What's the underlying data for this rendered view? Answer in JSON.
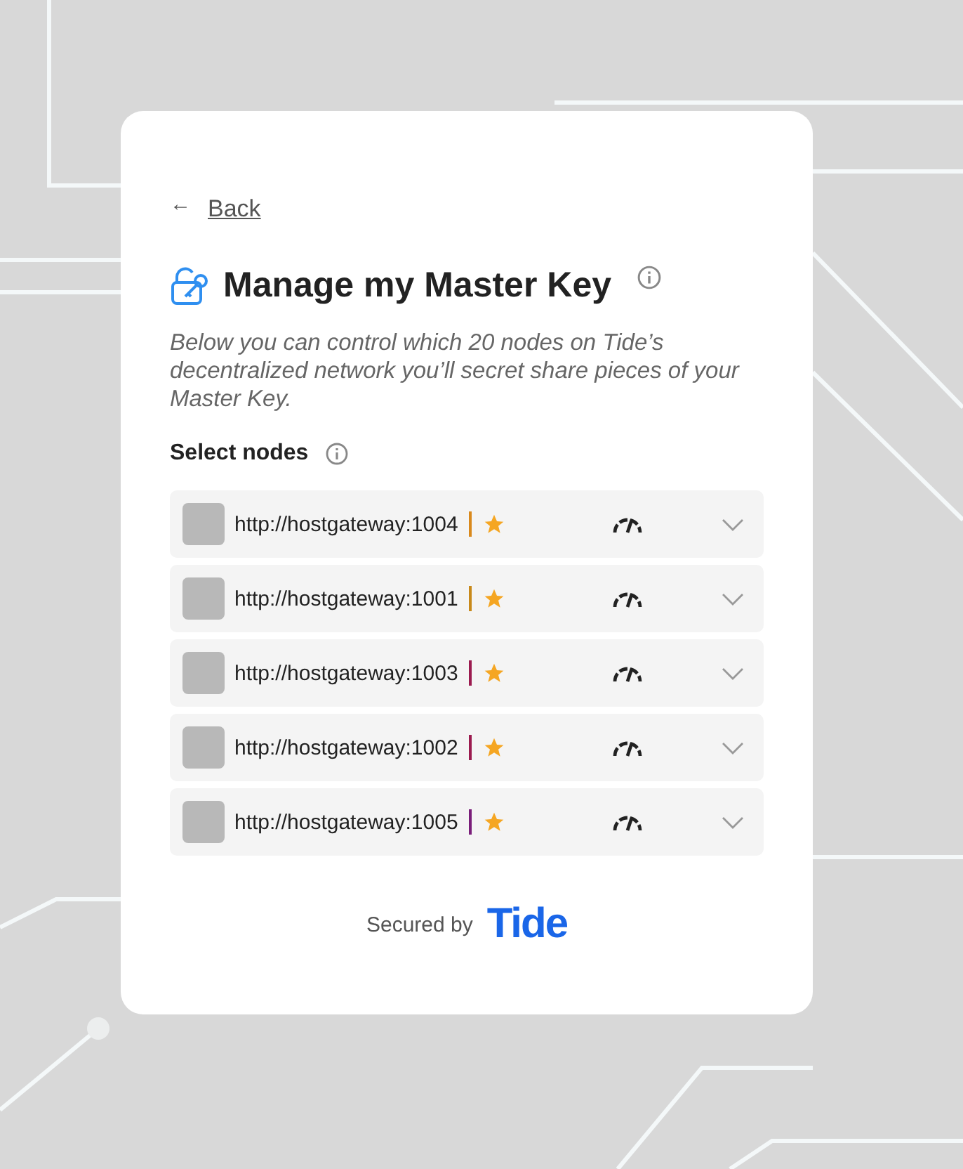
{
  "back": {
    "arrow": "←",
    "label": "Back"
  },
  "title": "Manage my Master Key",
  "description": "Below you can control which 20 nodes on Tide’s decentralized network you’ll secret share pieces of your Master Key.",
  "section_label": "Select nodes",
  "nodes": [
    {
      "url": "http://hostgateway:1004",
      "color": "#d9891c"
    },
    {
      "url": "http://hostgateway:1001",
      "color": "#c8891a"
    },
    {
      "url": "http://hostgateway:1003",
      "color": "#9b1b4f"
    },
    {
      "url": "http://hostgateway:1002",
      "color": "#9b1b4f"
    },
    {
      "url": "http://hostgateway:1005",
      "color": "#7a1e7a"
    }
  ],
  "footer": {
    "label": "Secured by",
    "logo": "Tide"
  }
}
